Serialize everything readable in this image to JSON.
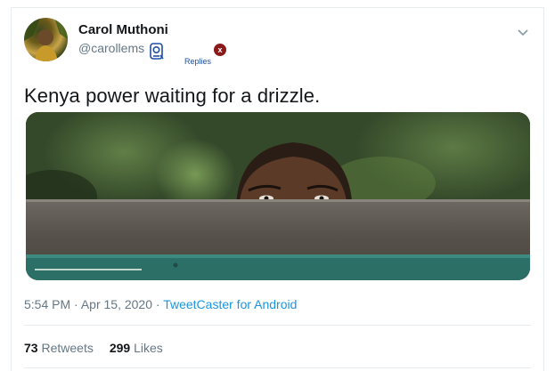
{
  "tweet": {
    "author_name": "Carol Muthoni",
    "author_handle": "@carollems",
    "replies_label": "Replies",
    "close_label": "x",
    "text": "Kenya power waiting for a drizzle.",
    "time": "5:54 PM",
    "date": "Apr 15, 2020",
    "separator": "·",
    "source": "TweetCaster for Android",
    "retweets_count": "73",
    "retweets_label": "Retweets",
    "likes_count": "299",
    "likes_label": "Likes"
  },
  "icons": {
    "menu": "chevron-down-icon",
    "badge": "badge-icon",
    "close": "close-icon"
  },
  "colors": {
    "text": "#14171a",
    "secondary": "#657786",
    "link": "#1b95e0",
    "border": "#e6ecf0"
  }
}
